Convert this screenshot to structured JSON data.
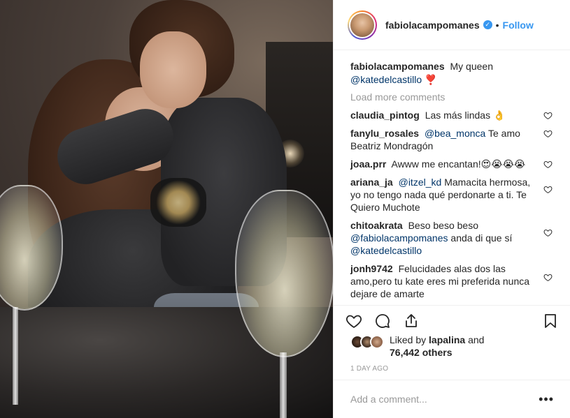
{
  "post": {
    "username": "fabiolacampomanes",
    "verified_badge": "✓",
    "separator": "•",
    "follow_label": "Follow",
    "caption": {
      "username": "fabiolacampomanes",
      "text": "My queen",
      "mention": "@katedelcastillo",
      "emoji": "❣️"
    },
    "load_more_label": "Load more comments",
    "comments": [
      {
        "username": "claudia_pintog",
        "text": "Las más lindas 👌"
      },
      {
        "username": "fanylu_rosales",
        "mention": "@bea_monca",
        "text": "Te amo Beatriz Mondragón"
      },
      {
        "username": "joaa.prr",
        "text": "Awww me encantan!😍😭😭😭"
      },
      {
        "username": "ariana_ja",
        "mention": "@itzel_kd",
        "text": "Mamacita hermosa, yo no tengo nada qué perdonarte a ti. Te Quiero Muchote"
      },
      {
        "username": "chitoakrata",
        "text": "Beso beso beso",
        "mention": "@fabiolacampomanes",
        "text2": "anda di que sí",
        "mention2": "@katedelcastillo"
      },
      {
        "username": "jonh9742",
        "text": "Felucidades alas dos las amo,pero tu kate eres mi preferida nunca dejare de amarte"
      }
    ],
    "likes": {
      "prefix": "Liked by",
      "liked_by_user": "lapalina",
      "and": "and",
      "count": "76,442 others"
    },
    "timestamp": "1 DAY AGO",
    "add_comment_placeholder": "Add a comment...",
    "more_label": "•••"
  },
  "colors": {
    "link_blue": "#3897f0",
    "mention_blue": "#003569",
    "muted_gray": "#999999",
    "text": "#262626"
  },
  "icons": [
    "heart-icon",
    "comment-icon",
    "share-icon",
    "bookmark-icon",
    "more-options-icon",
    "verified-badge-icon"
  ]
}
